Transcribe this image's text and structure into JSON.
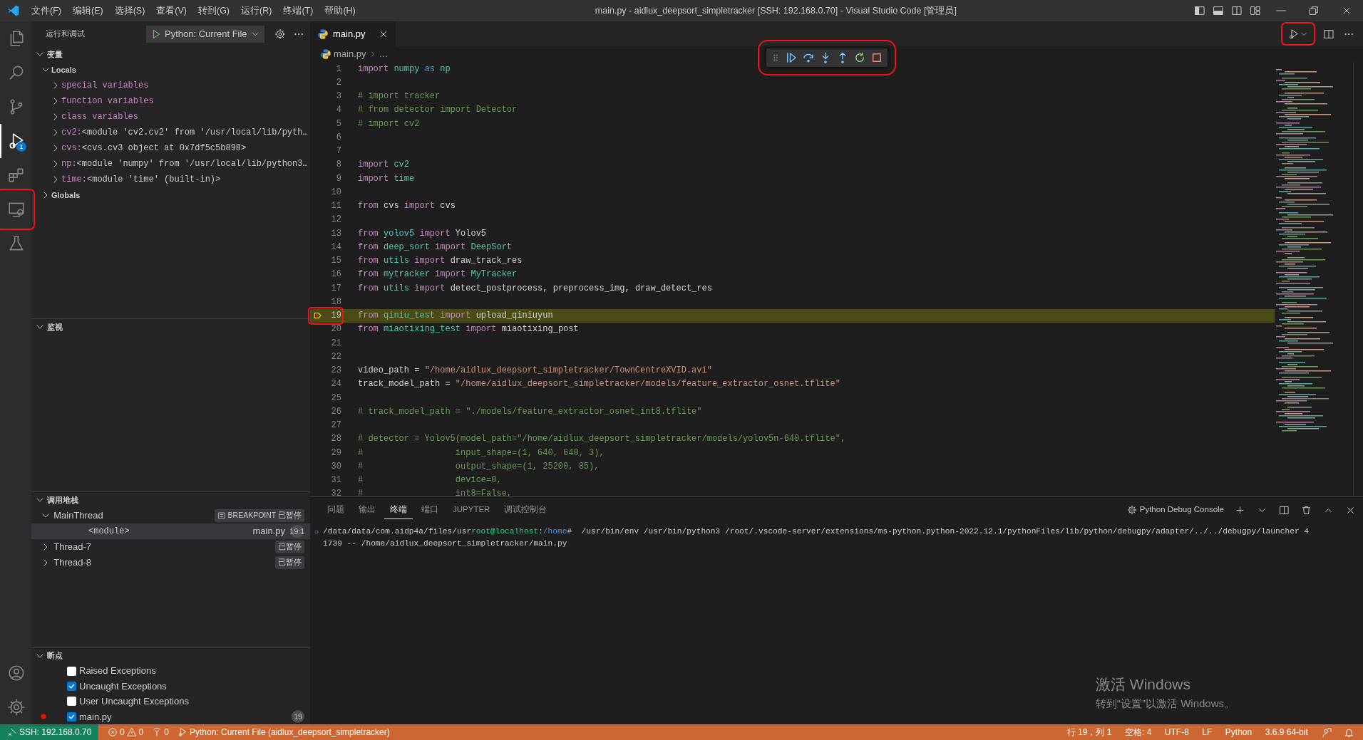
{
  "title_bar": {
    "menu": [
      "文件(F)",
      "编辑(E)",
      "选择(S)",
      "查看(V)",
      "转到(G)",
      "运行(R)",
      "终端(T)",
      "帮助(H)"
    ],
    "title": "main.py - aidlux_deepsort_simpletracker [SSH: 192.168.0.70] - Visual Studio Code [管理员]"
  },
  "activity_bar": {
    "items": [
      {
        "selected": false,
        "annotated": false
      },
      {
        "selected": false,
        "annotated": false
      },
      {
        "selected": false,
        "annotated": false
      },
      {
        "selected": true,
        "annotated": false,
        "badge": "1"
      },
      {
        "selected": false,
        "annotated": false
      },
      {
        "selected": false,
        "annotated": true
      },
      {
        "selected": false,
        "annotated": false
      }
    ]
  },
  "sidebar": {
    "title": "运行和调试",
    "config": "Python: Current File",
    "variables": {
      "title": "变量",
      "expanded": true,
      "scopes": [
        {
          "label": "Locals",
          "expanded": true,
          "children": [
            {
              "name": "special variables"
            },
            {
              "name": "function variables"
            },
            {
              "name": "class variables"
            },
            {
              "name": "cv2:",
              "value": "<module 'cv2.cv2' from '/usr/local/lib/pyth…"
            },
            {
              "name": "cvs:",
              "value": "<cvs.cv3 object at 0x7df5c5b898>"
            },
            {
              "name": "np:",
              "value": "<module 'numpy' from '/usr/local/lib/python3…"
            },
            {
              "name": "time:",
              "value": "<module 'time' (built-in)>"
            }
          ]
        },
        {
          "label": "Globals",
          "expanded": false
        }
      ]
    },
    "watch": {
      "title": "监视",
      "expanded": true
    },
    "call_stack": {
      "title": "调用堆栈",
      "expanded": true,
      "threads": [
        {
          "label": "MainThread",
          "expanded": true,
          "status": "BREAKPOINT 已暂停",
          "frames": [
            {
              "label": "<module>",
              "file": "main.py",
              "position": "19:1",
              "selected": true
            }
          ]
        },
        {
          "label": "Thread-7",
          "expanded": false,
          "status": "已暂停"
        },
        {
          "label": "Thread-8",
          "expanded": false,
          "status": "已暂停"
        }
      ]
    },
    "breakpoints": {
      "title": "断点",
      "expanded": true,
      "items": [
        {
          "kind": "exception",
          "label": "Raised Exceptions",
          "checked": false
        },
        {
          "kind": "exception",
          "label": "Uncaught Exceptions",
          "checked": true
        },
        {
          "kind": "exception",
          "label": "User Uncaught Exceptions",
          "checked": false
        },
        {
          "kind": "file",
          "label": "main.py",
          "checked": true,
          "count": "19"
        }
      ]
    }
  },
  "editor": {
    "tabs": [
      {
        "label": "main.py",
        "selected": true
      }
    ],
    "breadcrumb": [
      "main.py",
      "…"
    ],
    "run_button": {
      "annotated": true
    },
    "debug_toolbar": {
      "annotated": true
    },
    "lines": [
      {
        "n": "1",
        "current": false,
        "annotated": false,
        "tokens": [
          {
            "text": "import",
            "kind": "keyword"
          },
          {
            "text": "numpy",
            "kind": "module"
          },
          {
            "text": "as",
            "kind": "as"
          },
          {
            "text": "np",
            "kind": "module"
          }
        ]
      },
      {
        "n": "2",
        "current": false,
        "annotated": false
      },
      {
        "n": "3",
        "current": false,
        "annotated": false,
        "tokens": [
          {
            "text": "# import tracker",
            "kind": "comment"
          }
        ]
      },
      {
        "n": "4",
        "current": false,
        "annotated": false,
        "tokens": [
          {
            "text": "# from detector import Detector",
            "kind": "comment"
          }
        ]
      },
      {
        "n": "5",
        "current": false,
        "annotated": false,
        "tokens": [
          {
            "text": "# import cv2",
            "kind": "comment"
          }
        ]
      },
      {
        "n": "6",
        "current": false,
        "annotated": false
      },
      {
        "n": "7",
        "current": false,
        "annotated": false
      },
      {
        "n": "8",
        "current": false,
        "annotated": false,
        "tokens": [
          {
            "text": "import",
            "kind": "keyword"
          },
          {
            "text": "cv2",
            "kind": "module"
          }
        ]
      },
      {
        "n": "9",
        "current": false,
        "annotated": false,
        "tokens": [
          {
            "text": "import",
            "kind": "keyword"
          },
          {
            "text": "time",
            "kind": "module"
          }
        ]
      },
      {
        "n": "10",
        "current": false,
        "annotated": false
      },
      {
        "n": "11",
        "current": false,
        "annotated": false,
        "tokens": [
          {
            "text": "from",
            "kind": "keyword"
          },
          {
            "text": "cvs",
            "kind": "plain"
          },
          {
            "text": "import",
            "kind": "keyword"
          },
          {
            "text": "cvs",
            "kind": "plain"
          }
        ]
      },
      {
        "n": "12",
        "current": false,
        "annotated": false
      },
      {
        "n": "13",
        "current": false,
        "annotated": false,
        "tokens": [
          {
            "text": "from",
            "kind": "keyword"
          },
          {
            "text": "yolov5",
            "kind": "module"
          },
          {
            "text": "import",
            "kind": "keyword"
          },
          {
            "text": "Yolov5",
            "kind": "plain"
          }
        ]
      },
      {
        "n": "14",
        "current": false,
        "annotated": false,
        "tokens": [
          {
            "text": "from",
            "kind": "keyword"
          },
          {
            "text": "deep_sort",
            "kind": "module"
          },
          {
            "text": "import",
            "kind": "keyword"
          },
          {
            "text": "DeepSort",
            "kind": "module"
          }
        ]
      },
      {
        "n": "15",
        "current": false,
        "annotated": false,
        "tokens": [
          {
            "text": "from",
            "kind": "keyword"
          },
          {
            "text": "utils",
            "kind": "module"
          },
          {
            "text": "import",
            "kind": "keyword"
          },
          {
            "text": "draw_track_res",
            "kind": "plain"
          }
        ]
      },
      {
        "n": "16",
        "current": false,
        "annotated": false,
        "tokens": [
          {
            "text": "from",
            "kind": "keyword"
          },
          {
            "text": "mytracker",
            "kind": "module"
          },
          {
            "text": "import",
            "kind": "keyword"
          },
          {
            "text": "MyTracker",
            "kind": "module"
          }
        ]
      },
      {
        "n": "17",
        "current": false,
        "annotated": false,
        "tokens": [
          {
            "text": "from",
            "kind": "keyword"
          },
          {
            "text": "utils",
            "kind": "module"
          },
          {
            "text": "import",
            "kind": "keyword"
          },
          {
            "text": "detect_postprocess, preprocess_img, draw_detect_res",
            "kind": "plain"
          }
        ]
      },
      {
        "n": "18",
        "current": false,
        "annotated": false
      },
      {
        "n": "19",
        "current": true,
        "annotated": true,
        "tokens": [
          {
            "text": "from",
            "kind": "keyword"
          },
          {
            "text": "qiniu_test",
            "kind": "module"
          },
          {
            "text": "import",
            "kind": "keyword"
          },
          {
            "text": "upload_qiniuyun",
            "kind": "plain"
          }
        ]
      },
      {
        "n": "20",
        "current": false,
        "annotated": false,
        "tokens": [
          {
            "text": "from",
            "kind": "keyword"
          },
          {
            "text": "miaotixing_test",
            "kind": "module"
          },
          {
            "text": "import",
            "kind": "keyword"
          },
          {
            "text": "miaotixing_post",
            "kind": "plain"
          }
        ]
      },
      {
        "n": "21",
        "current": false,
        "annotated": false
      },
      {
        "n": "22",
        "current": false,
        "annotated": false
      },
      {
        "n": "23",
        "current": false,
        "annotated": false,
        "tokens": [
          {
            "text": "video_path",
            "kind": "plain"
          },
          {
            "text": "=",
            "kind": "plain"
          },
          {
            "text": "\"/home/aidlux_deepsort_simpletracker/TownCentreXVID.avi\"",
            "kind": "string"
          }
        ]
      },
      {
        "n": "24",
        "current": false,
        "annotated": false,
        "tokens": [
          {
            "text": "track_model_path",
            "kind": "plain"
          },
          {
            "text": "=",
            "kind": "plain"
          },
          {
            "text": "\"/home/aidlux_deepsort_simpletracker/models/feature_extractor_osnet.tflite\"",
            "kind": "string"
          }
        ]
      },
      {
        "n": "25",
        "current": false,
        "annotated": false
      },
      {
        "n": "26",
        "current": false,
        "annotated": false,
        "tokens": [
          {
            "text": "# track_model_path = \"./models/feature_extractor_osnet_int8.tflite\"",
            "kind": "comment"
          }
        ]
      },
      {
        "n": "27",
        "current": false,
        "annotated": false
      },
      {
        "n": "28",
        "current": false,
        "annotated": false,
        "tokens": [
          {
            "text": "# detector = Yolov5(model_path=\"/home/aidlux_deepsort_simpletracker/models/yolov5n-640.tflite\",",
            "kind": "comment"
          }
        ]
      },
      {
        "n": "29",
        "current": false,
        "annotated": false,
        "tokens": [
          {
            "text": "#                  input_shape=(1, 640, 640, 3),",
            "kind": "comment"
          }
        ]
      },
      {
        "n": "30",
        "current": false,
        "annotated": false,
        "tokens": [
          {
            "text": "#                  output_shape=(1, 25200, 85),",
            "kind": "comment"
          }
        ]
      },
      {
        "n": "31",
        "current": false,
        "annotated": false,
        "tokens": [
          {
            "text": "#                  device=0,",
            "kind": "comment"
          }
        ]
      },
      {
        "n": "32",
        "current": false,
        "annotated": false,
        "tokens": [
          {
            "text": "#                  int8=False,",
            "kind": "comment"
          }
        ]
      }
    ]
  },
  "panel": {
    "tabs": [
      {
        "label": "问题",
        "selected": false
      },
      {
        "label": "输出",
        "selected": false
      },
      {
        "label": "终端",
        "selected": true
      },
      {
        "label": "端口",
        "selected": false
      },
      {
        "label": "JUPYTER",
        "selected": false
      },
      {
        "label": "调试控制台",
        "selected": false
      }
    ],
    "terminal_name": "Python Debug Console",
    "terminal": [
      [
        {
          "text": "/data/data/com.aidp4a/files/usr",
          "kind": "plain"
        },
        {
          "text": "root@localhost",
          "kind": "user"
        },
        {
          "text": ":",
          "kind": "plain"
        },
        {
          "text": "/home",
          "kind": "path"
        },
        {
          "text": "#  /usr/bin/env /usr/bin/python3 /root/.vscode-server/extensions/ms-python.python-2022.12.1/pythonFiles/lib/python/debugpy/adapter/../../debugpy/launcher 4",
          "kind": "plain"
        }
      ],
      [
        {
          "text": "1739 -- /home/aidlux_deepsort_simpletracker/main.py",
          "kind": "plain"
        }
      ]
    ]
  },
  "activation_notice": {
    "title": "激活 Windows",
    "text": "转到“设置”以激活 Windows。"
  },
  "status_bar": {
    "remote": "SSH: 192.168.0.70",
    "errors": "0",
    "warnings": "0",
    "ports": "0",
    "launch": "Python: Current File (aidlux_deepsort_simpletracker)",
    "right": [
      "行 19，列 1",
      "空格: 4",
      "UTF-8",
      "LF",
      "Python",
      "3.6.9 64-bit"
    ]
  }
}
